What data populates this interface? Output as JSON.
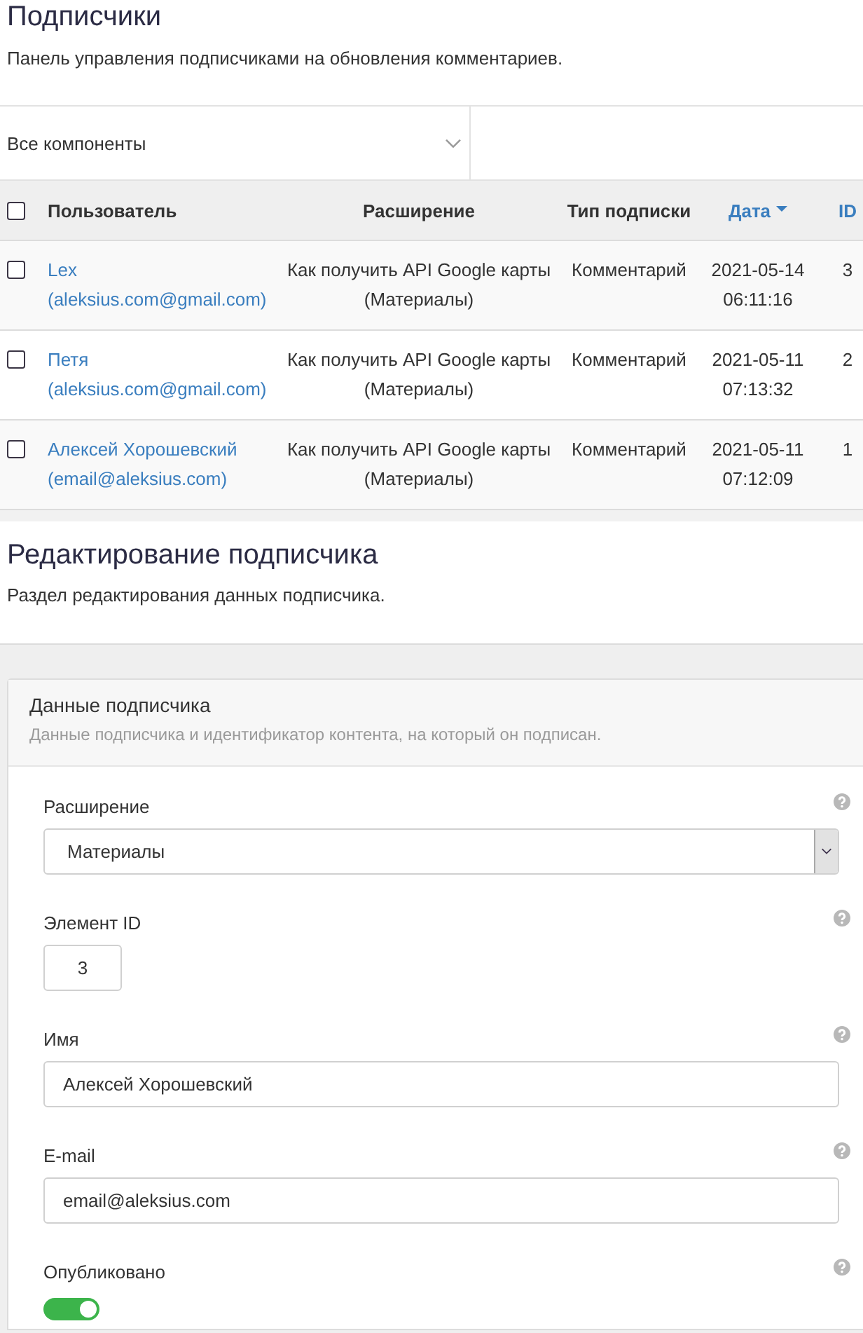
{
  "page": {
    "title": "Подписчики",
    "description": "Панель управления подписчиками на обновления комментариев."
  },
  "filter": {
    "value": "Все компоненты"
  },
  "table": {
    "select_all": {
      "checked": false
    },
    "columns": [
      {
        "label": "Пользователь",
        "sortable": false,
        "sorted": false
      },
      {
        "label": "Расширение",
        "sortable": false,
        "sorted": false
      },
      {
        "label": "Тип подписки",
        "sortable": false,
        "sorted": false
      },
      {
        "label": "Дата",
        "sortable": true,
        "sorted": true
      },
      {
        "label": "ID",
        "sortable": true,
        "sorted": false
      }
    ],
    "rows": [
      {
        "checked": false,
        "name": "Lex",
        "email": "(aleksius.com@gmail.com)",
        "content": "Как получить API Google карты",
        "extension": "(Материалы)",
        "type": "Комментарий",
        "date": "2021-05-14 06:11:16",
        "id": "3"
      },
      {
        "checked": false,
        "name": "Петя",
        "email": "(aleksius.com@gmail.com)",
        "content": "Как получить API Google карты",
        "extension": "(Материалы)",
        "type": "Комментарий",
        "date": "2021-05-11 07:13:32",
        "id": "2"
      },
      {
        "checked": false,
        "name": "Алексей Хорошевский",
        "email": "(email@aleksius.com)",
        "content": "Как получить API Google карты",
        "extension": "(Материалы)",
        "type": "Комментарий",
        "date": "2021-05-11 07:12:09",
        "id": "1"
      }
    ]
  },
  "edit": {
    "title": "Редактирование подписчика",
    "description": "Раздел редактирования данных подписчика."
  },
  "card": {
    "title": "Данные подписчика",
    "description": "Данные подписчика и идентификатор контента, на который он подписан."
  },
  "fields": [
    {
      "kind": "select",
      "label": "Расширение",
      "value": "Материалы"
    },
    {
      "kind": "number",
      "label": "Элемент ID",
      "value": "3"
    },
    {
      "kind": "text",
      "label": "Имя",
      "value": "Алексей Хорошевский"
    },
    {
      "kind": "text",
      "label": "E-mail",
      "value": "email@aleksius.com"
    },
    {
      "kind": "toggle",
      "label": "Опубликовано",
      "on": true
    }
  ]
}
